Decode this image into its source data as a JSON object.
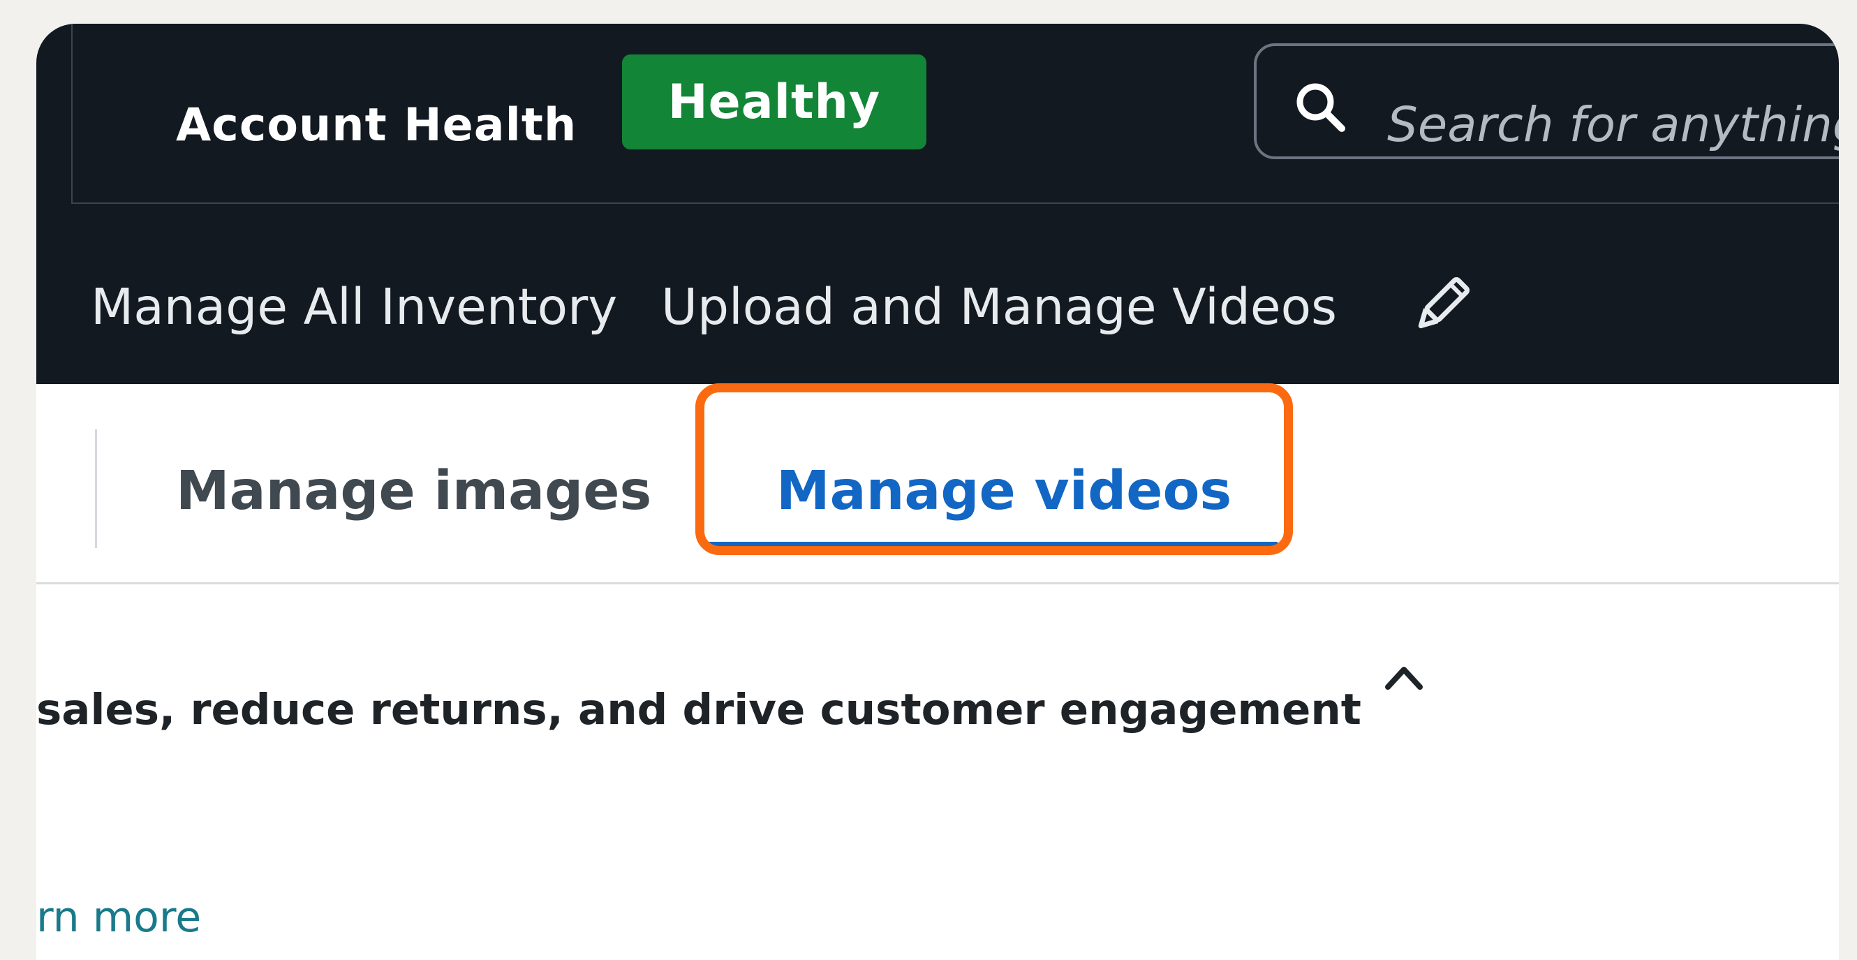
{
  "header": {
    "account_health_label": "Account Health",
    "account_health_status": "Healthy",
    "status_color": "#128537",
    "search": {
      "placeholder": "Search for anything"
    }
  },
  "nav": {
    "items": [
      {
        "label": "Manage All Inventory"
      },
      {
        "label": "Upload and Manage Videos"
      }
    ],
    "edit_icon": "pencil-icon"
  },
  "tabs": [
    {
      "label": "Manage images",
      "active": false
    },
    {
      "label": "Manage videos",
      "active": true
    }
  ],
  "highlight_color": "#fb6a10",
  "accent_color": "#1266c4",
  "banner": {
    "text": "sales, reduce returns, and drive customer engagement",
    "toggle_icon": "chevron-up-icon"
  },
  "learn_more": "rn more"
}
